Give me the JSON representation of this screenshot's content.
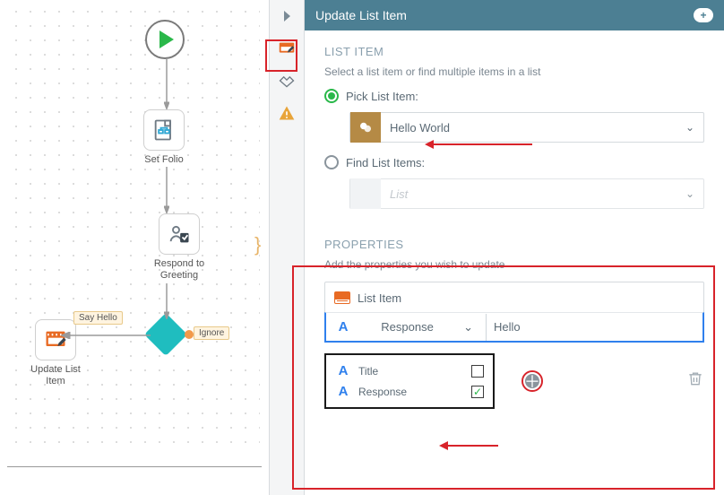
{
  "header": {
    "title": "Update List Item"
  },
  "flow": {
    "nodes": {
      "set_folio": "Set Folio",
      "respond": "Respond to Greeting",
      "update": "Update List Item"
    },
    "edges": {
      "say_hello": "Say Hello",
      "ignore": "Ignore"
    }
  },
  "panel": {
    "list_item": {
      "section": "LIST ITEM",
      "helper": "Select a list item or find multiple items in a list",
      "pick_label": "Pick List Item:",
      "find_label": "Find List Items:",
      "pick_value": "Hello World",
      "find_placeholder": "List"
    },
    "properties": {
      "section": "PROPERTIES",
      "helper": "Add the properties you wish to update",
      "root_label": "List Item",
      "field": "Response",
      "value": "Hello",
      "options": [
        {
          "name": "Title",
          "checked": false
        },
        {
          "name": "Response",
          "checked": true
        }
      ]
    }
  }
}
